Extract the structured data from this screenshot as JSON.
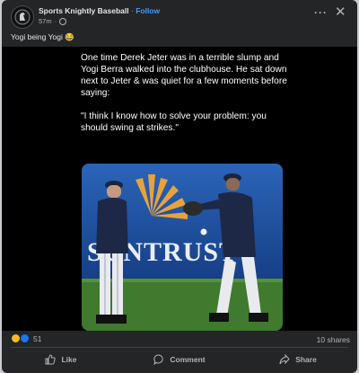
{
  "post": {
    "page_name": "Sports Knightly Baseball",
    "separator": "·",
    "follow_label": "Follow",
    "time_ago": "57m",
    "meta_separator": "·",
    "caption": "Yogi being Yogi 😂"
  },
  "image": {
    "quote_lines": [
      "One time Derek Jeter was in a terrible slump and Yogi Berra walked into the clubhouse. He sat down next to Jeter & was quiet for a few moments before saying:",
      "\"I think I know how to solve your problem: you should swing at strikes.\""
    ],
    "sign_text": "SUNTRUST"
  },
  "stats": {
    "reaction_count": "51",
    "shares": "10 shares"
  },
  "actions": {
    "like": "Like",
    "comment": "Comment",
    "share": "Share"
  },
  "colors": {
    "card_bg": "#242526",
    "accent": "#4599ff",
    "text_secondary": "#b0b3b8"
  }
}
